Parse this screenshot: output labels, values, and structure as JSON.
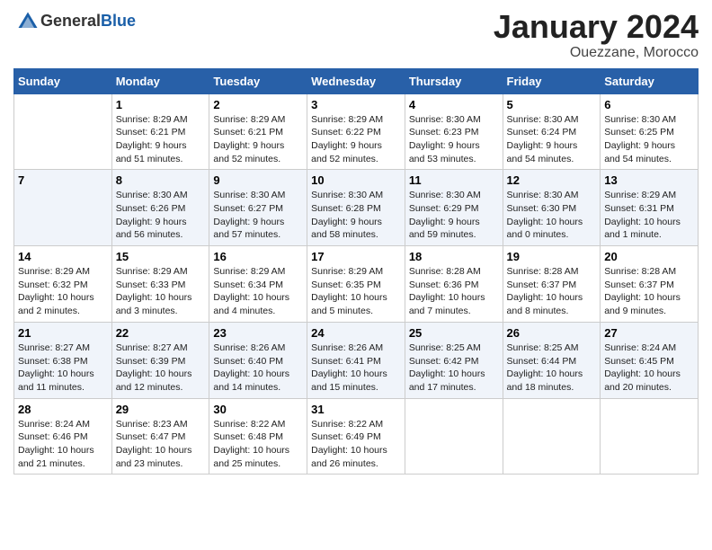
{
  "header": {
    "logo_general": "General",
    "logo_blue": "Blue",
    "title": "January 2024",
    "subtitle": "Ouezzane, Morocco"
  },
  "weekdays": [
    "Sunday",
    "Monday",
    "Tuesday",
    "Wednesday",
    "Thursday",
    "Friday",
    "Saturday"
  ],
  "weeks": [
    [
      {
        "day": "",
        "info": ""
      },
      {
        "day": "1",
        "info": "Sunrise: 8:29 AM\nSunset: 6:21 PM\nDaylight: 9 hours\nand 51 minutes."
      },
      {
        "day": "2",
        "info": "Sunrise: 8:29 AM\nSunset: 6:21 PM\nDaylight: 9 hours\nand 52 minutes."
      },
      {
        "day": "3",
        "info": "Sunrise: 8:29 AM\nSunset: 6:22 PM\nDaylight: 9 hours\nand 52 minutes."
      },
      {
        "day": "4",
        "info": "Sunrise: 8:30 AM\nSunset: 6:23 PM\nDaylight: 9 hours\nand 53 minutes."
      },
      {
        "day": "5",
        "info": "Sunrise: 8:30 AM\nSunset: 6:24 PM\nDaylight: 9 hours\nand 54 minutes."
      },
      {
        "day": "6",
        "info": "Sunrise: 8:30 AM\nSunset: 6:25 PM\nDaylight: 9 hours\nand 54 minutes."
      }
    ],
    [
      {
        "day": "7",
        "info": ""
      },
      {
        "day": "8",
        "info": "Sunrise: 8:30 AM\nSunset: 6:26 PM\nDaylight: 9 hours\nand 56 minutes."
      },
      {
        "day": "9",
        "info": "Sunrise: 8:30 AM\nSunset: 6:27 PM\nDaylight: 9 hours\nand 57 minutes."
      },
      {
        "day": "10",
        "info": "Sunrise: 8:30 AM\nSunset: 6:28 PM\nDaylight: 9 hours\nand 58 minutes."
      },
      {
        "day": "11",
        "info": "Sunrise: 8:30 AM\nSunset: 6:29 PM\nDaylight: 9 hours\nand 59 minutes."
      },
      {
        "day": "12",
        "info": "Sunrise: 8:30 AM\nSunset: 6:30 PM\nDaylight: 10 hours\nand 0 minutes."
      },
      {
        "day": "13",
        "info": "Sunrise: 8:29 AM\nSunset: 6:31 PM\nDaylight: 10 hours\nand 1 minute."
      }
    ],
    [
      {
        "day": "14",
        "info": "Sunrise: 8:29 AM\nSunset: 6:32 PM\nDaylight: 10 hours\nand 2 minutes."
      },
      {
        "day": "15",
        "info": "Sunrise: 8:29 AM\nSunset: 6:33 PM\nDaylight: 10 hours\nand 3 minutes."
      },
      {
        "day": "16",
        "info": "Sunrise: 8:29 AM\nSunset: 6:34 PM\nDaylight: 10 hours\nand 4 minutes."
      },
      {
        "day": "17",
        "info": "Sunrise: 8:29 AM\nSunset: 6:35 PM\nDaylight: 10 hours\nand 5 minutes."
      },
      {
        "day": "18",
        "info": "Sunrise: 8:28 AM\nSunset: 6:36 PM\nDaylight: 10 hours\nand 7 minutes."
      },
      {
        "day": "19",
        "info": "Sunrise: 8:28 AM\nSunset: 6:37 PM\nDaylight: 10 hours\nand 8 minutes."
      },
      {
        "day": "20",
        "info": "Sunrise: 8:28 AM\nSunset: 6:37 PM\nDaylight: 10 hours\nand 9 minutes."
      }
    ],
    [
      {
        "day": "21",
        "info": "Sunrise: 8:27 AM\nSunset: 6:38 PM\nDaylight: 10 hours\nand 11 minutes."
      },
      {
        "day": "22",
        "info": "Sunrise: 8:27 AM\nSunset: 6:39 PM\nDaylight: 10 hours\nand 12 minutes."
      },
      {
        "day": "23",
        "info": "Sunrise: 8:26 AM\nSunset: 6:40 PM\nDaylight: 10 hours\nand 14 minutes."
      },
      {
        "day": "24",
        "info": "Sunrise: 8:26 AM\nSunset: 6:41 PM\nDaylight: 10 hours\nand 15 minutes."
      },
      {
        "day": "25",
        "info": "Sunrise: 8:25 AM\nSunset: 6:42 PM\nDaylight: 10 hours\nand 17 minutes."
      },
      {
        "day": "26",
        "info": "Sunrise: 8:25 AM\nSunset: 6:44 PM\nDaylight: 10 hours\nand 18 minutes."
      },
      {
        "day": "27",
        "info": "Sunrise: 8:24 AM\nSunset: 6:45 PM\nDaylight: 10 hours\nand 20 minutes."
      }
    ],
    [
      {
        "day": "28",
        "info": "Sunrise: 8:24 AM\nSunset: 6:46 PM\nDaylight: 10 hours\nand 21 minutes."
      },
      {
        "day": "29",
        "info": "Sunrise: 8:23 AM\nSunset: 6:47 PM\nDaylight: 10 hours\nand 23 minutes."
      },
      {
        "day": "30",
        "info": "Sunrise: 8:22 AM\nSunset: 6:48 PM\nDaylight: 10 hours\nand 25 minutes."
      },
      {
        "day": "31",
        "info": "Sunrise: 8:22 AM\nSunset: 6:49 PM\nDaylight: 10 hours\nand 26 minutes."
      },
      {
        "day": "",
        "info": ""
      },
      {
        "day": "",
        "info": ""
      },
      {
        "day": "",
        "info": ""
      }
    ]
  ]
}
